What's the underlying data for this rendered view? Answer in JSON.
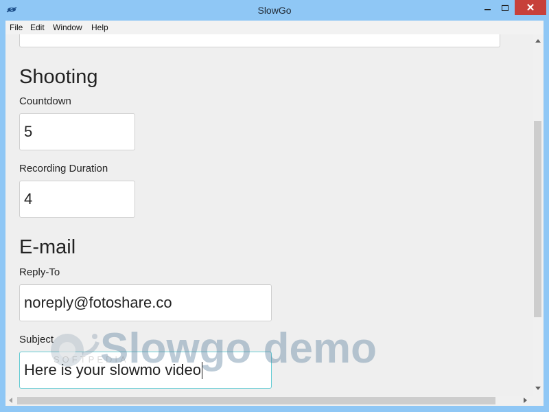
{
  "window": {
    "title": "SlowGo",
    "close_glyph": "✕"
  },
  "menu": {
    "items": [
      "File",
      "Edit",
      "Window",
      "Help"
    ]
  },
  "shooting": {
    "heading": "Shooting",
    "countdown_label": "Countdown",
    "countdown_value": "5",
    "duration_label": "Recording Duration",
    "duration_value": "4"
  },
  "email": {
    "heading": "E-mail",
    "reply_to_label": "Reply-To",
    "reply_to_value": "noreply@fotoshare.co",
    "subject_label": "Subject",
    "subject_value": "Here is your slowmo video"
  },
  "watermark": {
    "text": "Slowgo demo",
    "sub": "SOFTPEDIA"
  },
  "icons": {
    "app": "app-icon",
    "minimize": "minimize-icon",
    "maximize": "maximize-icon",
    "close": "close-icon"
  }
}
